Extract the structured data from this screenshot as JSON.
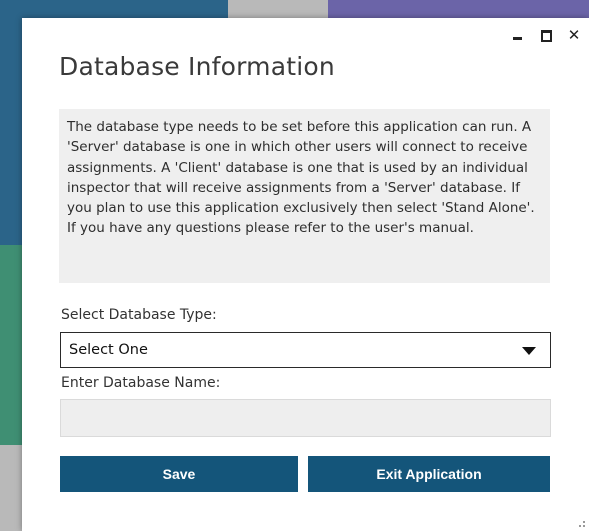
{
  "dialog": {
    "title": "Database Information",
    "description": "The database type needs to be set before this application can run. A 'Server' database is one in which other users will connect to receive assignments. A 'Client' database is one that is used by an individual inspector that will receive assignments from a 'Server' database. If you plan to use this application exclusively then select 'Stand Alone'. If you have any questions please refer to the user's manual.",
    "type_label": "Select Database Type:",
    "type_select": {
      "selected": "Select One"
    },
    "name_label": "Enter Database Name:",
    "name_input": {
      "value": "",
      "placeholder": ""
    },
    "save_label": "Save",
    "exit_label": "Exit Application"
  },
  "window_controls": {
    "minimize": "minimize",
    "maximize": "maximize",
    "close": "close"
  },
  "colors": {
    "button_bg": "#14557a",
    "button_text": "#ffffff",
    "info_bg": "#efefef"
  }
}
